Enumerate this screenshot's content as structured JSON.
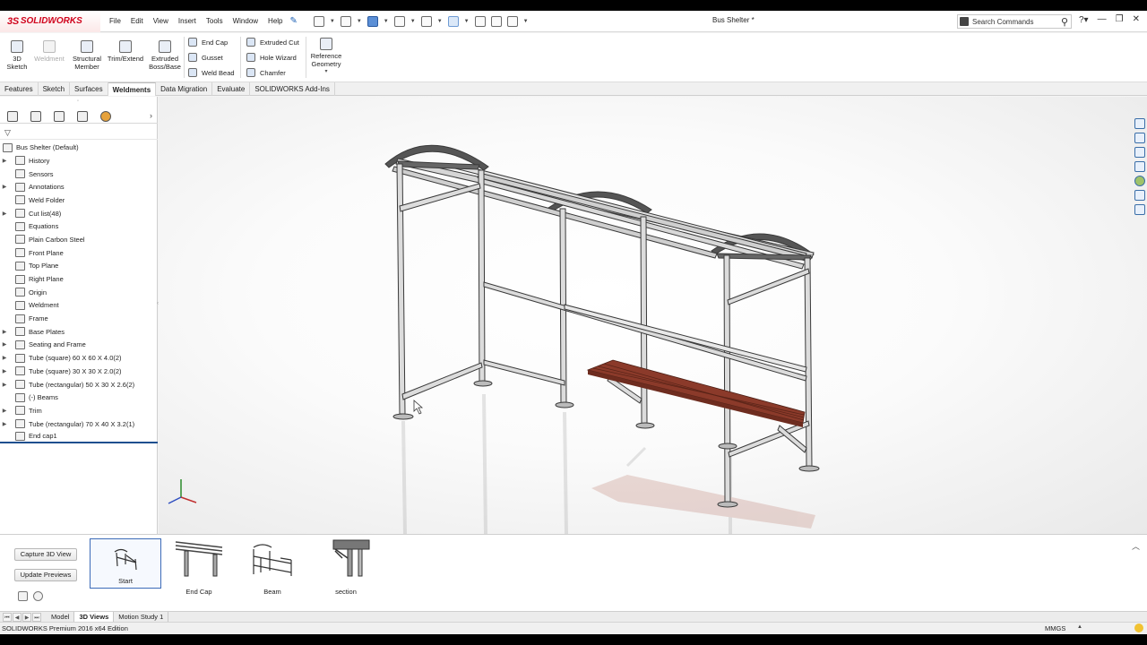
{
  "app": {
    "logo_mark": "3S",
    "logo_name": "SOLIDWORKS",
    "document_title": "Bus Shelter *",
    "search_placeholder": "Search Commands"
  },
  "menu": [
    "File",
    "Edit",
    "View",
    "Insert",
    "Tools",
    "Window",
    "Help"
  ],
  "command_manager": {
    "big_buttons": [
      {
        "label": "3D\nSketch",
        "icon": "3d-sketch-icon",
        "enabled": true
      },
      {
        "label": "Weldment",
        "icon": "weldment-icon",
        "enabled": false
      },
      {
        "label": "Structural\nMember",
        "icon": "structural-member-icon",
        "enabled": true
      },
      {
        "label": "Trim/Extend",
        "icon": "trim-extend-icon",
        "enabled": true
      },
      {
        "label": "Extruded\nBoss/Base",
        "icon": "extruded-boss-icon",
        "enabled": true
      }
    ],
    "small_buttons_col1": [
      "End Cap",
      "Gusset",
      "Weld Bead"
    ],
    "small_buttons_col2": [
      "Extruded Cut",
      "Hole Wizard",
      "Chamfer"
    ],
    "reference_geometry": "Reference\nGeometry"
  },
  "tabs": [
    "Features",
    "Sketch",
    "Surfaces",
    "Weldments",
    "Data Migration",
    "Evaluate",
    "SOLIDWORKS Add-Ins"
  ],
  "active_tab": "Weldments",
  "feature_tree": {
    "root": "Bus Shelter  (Default)",
    "items": [
      {
        "label": "History",
        "expandable": true,
        "icon": "history-icon"
      },
      {
        "label": "Sensors",
        "expandable": false,
        "icon": "sensors-icon"
      },
      {
        "label": "Annotations",
        "expandable": true,
        "icon": "annotations-icon"
      },
      {
        "label": "Weld Folder",
        "expandable": false,
        "icon": "weld-folder-icon"
      },
      {
        "label": "Cut list(48)",
        "expandable": true,
        "icon": "cut-list-icon"
      },
      {
        "label": "Equations",
        "expandable": false,
        "icon": "equations-icon"
      },
      {
        "label": "Plain Carbon Steel",
        "expandable": false,
        "icon": "material-icon"
      },
      {
        "label": "Front Plane",
        "expandable": false,
        "icon": "plane-icon"
      },
      {
        "label": "Top Plane",
        "expandable": false,
        "icon": "plane-icon"
      },
      {
        "label": "Right Plane",
        "expandable": false,
        "icon": "plane-icon"
      },
      {
        "label": "Origin",
        "expandable": false,
        "icon": "origin-icon"
      },
      {
        "label": "Weldment",
        "expandable": false,
        "icon": "weldment-icon"
      },
      {
        "label": "Frame",
        "expandable": false,
        "icon": "sketch-icon"
      },
      {
        "label": "Base Plates",
        "expandable": true,
        "icon": "feature-icon"
      },
      {
        "label": "Seating and Frame",
        "expandable": true,
        "icon": "folder-icon"
      },
      {
        "label": "Tube (square) 60 X 60 X 4.0(2)",
        "expandable": true,
        "icon": "structural-member-icon"
      },
      {
        "label": "Tube (square) 30 X 30 X 2.0(2)",
        "expandable": true,
        "icon": "structural-member-icon"
      },
      {
        "label": "Tube (rectangular) 50 X 30 X 2.6(2)",
        "expandable": true,
        "icon": "structural-member-icon"
      },
      {
        "label": "(-) Beams",
        "expandable": false,
        "icon": "3d-sketch-icon"
      },
      {
        "label": "Trim",
        "expandable": true,
        "icon": "folder-icon"
      },
      {
        "label": "Tube (rectangular) 70 X 40 X 3.2(1)",
        "expandable": true,
        "icon": "structural-member-icon"
      },
      {
        "label": "End cap1",
        "expandable": false,
        "icon": "end-cap-icon"
      }
    ]
  },
  "views_panel": {
    "capture_button": "Capture 3D View",
    "update_button": "Update Previews",
    "views": [
      "Start",
      "End Cap",
      "Beam",
      "section"
    ],
    "selected_view": "Start"
  },
  "bottom_tabs": [
    "Model",
    "3D Views",
    "Motion Study 1"
  ],
  "active_bottom_tab": "3D Views",
  "status": {
    "edition": "SOLIDWORKS Premium 2016 x64 Edition",
    "units": "MMGS"
  },
  "colors": {
    "brand_red": "#d0021b",
    "selection_blue": "#3c6bb8",
    "bench_wood": "#8b3a2a",
    "frame_steel": "#d8d8d8"
  }
}
